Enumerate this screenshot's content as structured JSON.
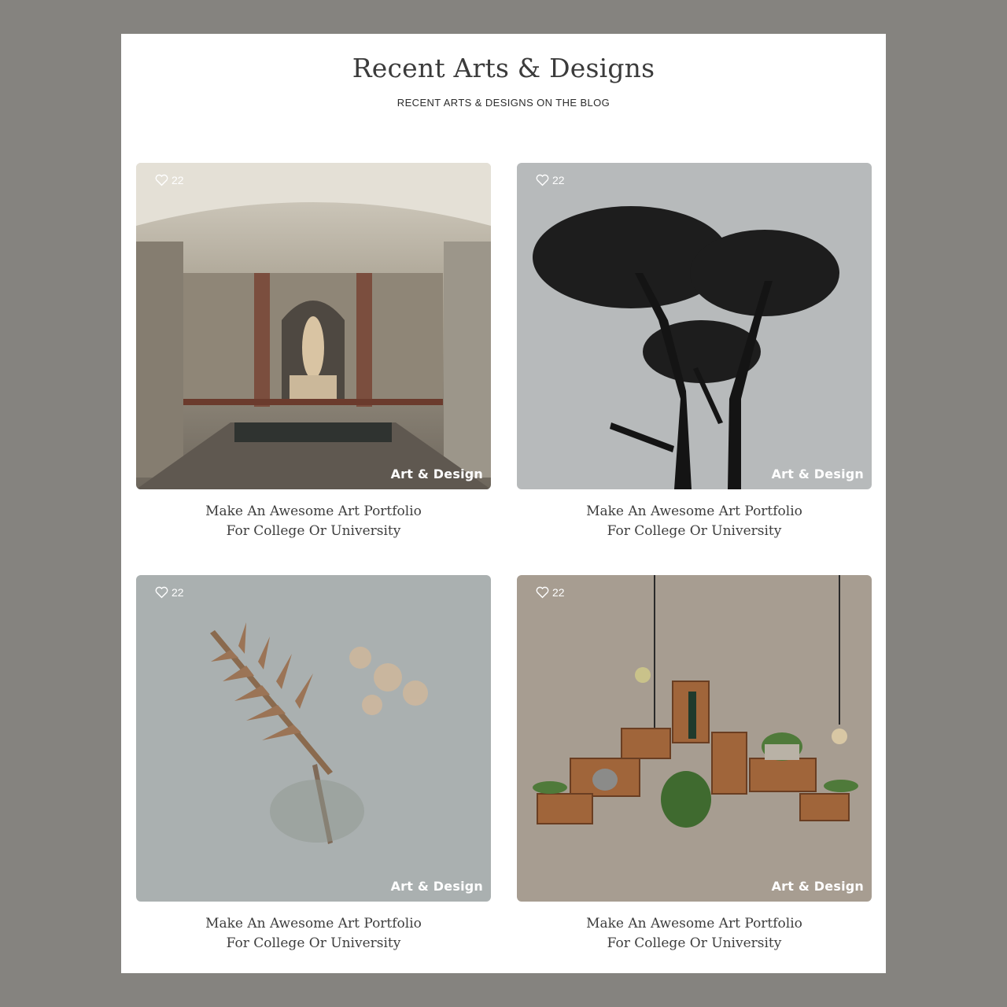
{
  "section": {
    "title": "Recent Arts & Designs",
    "subtitle": "RECENT ARTS & DESIGNS ON THE BLOG"
  },
  "colors": {
    "page_background": "#85837f",
    "panel": "#ffffff",
    "text_dark": "#3d3d3d"
  },
  "posts": [
    {
      "likes": "22",
      "category": "Art & Design",
      "title_line1": "Make An Awesome Art Portfolio",
      "title_line2": "For College Or University",
      "image": "museum-gallery-statues"
    },
    {
      "likes": "22",
      "category": "Art & Design",
      "title_line1": "Make An Awesome Art Portfolio",
      "title_line2": "For College Or University",
      "image": "tree-silhouettes"
    },
    {
      "likes": "22",
      "category": "Art & Design",
      "title_line1": "Make An Awesome Art Portfolio",
      "title_line2": "For College Or University",
      "image": "dried-fern-flowers"
    },
    {
      "likes": "22",
      "category": "Art & Design",
      "title_line1": "Make An Awesome Art Portfolio",
      "title_line2": "For College Or University",
      "image": "wooden-shelves-plants"
    }
  ]
}
